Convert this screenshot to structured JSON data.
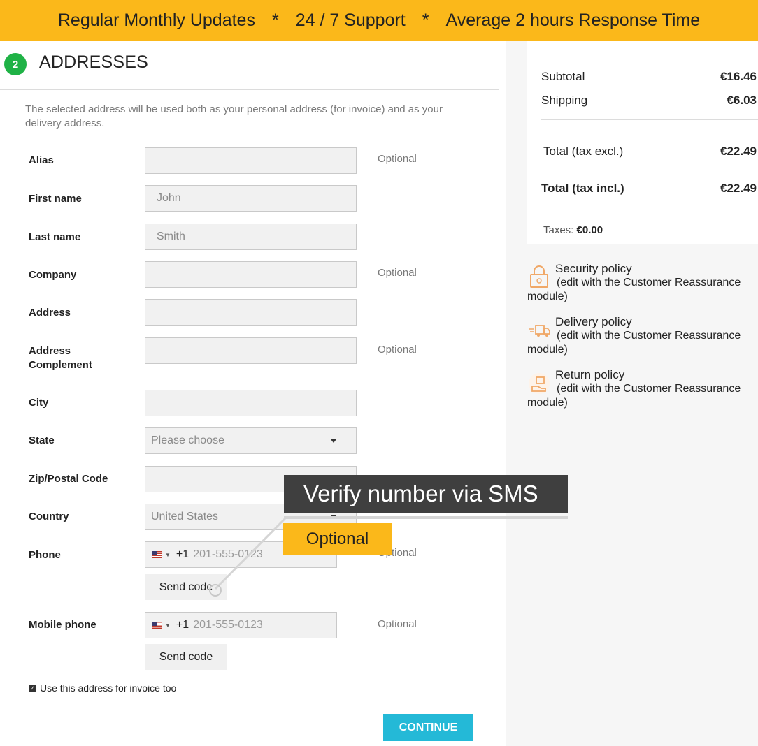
{
  "banner": {
    "item1": "Regular Monthly Updates",
    "sep": "*",
    "item2": "24 / 7 Support",
    "item3": "Average 2 hours Response Time"
  },
  "step": {
    "number": "2",
    "title": "ADDRESSES",
    "intro": "The selected address will be used both as your personal address (for invoice) and as your delivery address."
  },
  "form": {
    "optional_text": "Optional",
    "alias": {
      "label": "Alias",
      "value": ""
    },
    "first_name": {
      "label": "First name",
      "value": "John"
    },
    "last_name": {
      "label": "Last name",
      "value": "Smith"
    },
    "company": {
      "label": "Company",
      "value": ""
    },
    "address": {
      "label": "Address",
      "value": ""
    },
    "address_complement": {
      "label": "Address Complement",
      "value": ""
    },
    "city": {
      "label": "City",
      "value": ""
    },
    "state": {
      "label": "State",
      "value": "Please choose"
    },
    "zip": {
      "label": "Zip/Postal Code",
      "value": ""
    },
    "country": {
      "label": "Country",
      "value": "United States"
    },
    "phone": {
      "label": "Phone",
      "dial_code": "+1",
      "placeholder": "201-555-0123"
    },
    "mobile_phone": {
      "label": "Mobile phone",
      "dial_code": "+1",
      "placeholder": "201-555-0123"
    },
    "send_code": "Send code",
    "invoice_checkbox": "Use this address for invoice too",
    "continue": "CONTINUE"
  },
  "callout": {
    "title": "Verify number via SMS",
    "tag": "Optional"
  },
  "summary": {
    "subtotal_label": "Subtotal",
    "subtotal_value": "€16.46",
    "shipping_label": "Shipping",
    "shipping_value": "€6.03",
    "total_excl_label": "Total (tax excl.)",
    "total_excl_value": "€22.49",
    "total_incl_label": "Total (tax incl.)",
    "total_incl_value": "€22.49",
    "taxes_label": "Taxes:",
    "taxes_value": "€0.00"
  },
  "reassurance": [
    {
      "icon": "lock-icon",
      "title": "Security policy",
      "desc": "(edit with the Customer Reassurance module)"
    },
    {
      "icon": "truck-icon",
      "title": "Delivery policy",
      "desc": "(edit with the Customer Reassurance module)"
    },
    {
      "icon": "return-box-icon",
      "title": "Return policy",
      "desc": "(edit with the Customer Reassurance module)"
    }
  ],
  "colors": {
    "banner": "#fbb81a",
    "step_badge": "#1fb246",
    "continue_button": "#24b9d7",
    "callout_dark": "#3f3f3f",
    "icon_accent": "#f0a868"
  }
}
